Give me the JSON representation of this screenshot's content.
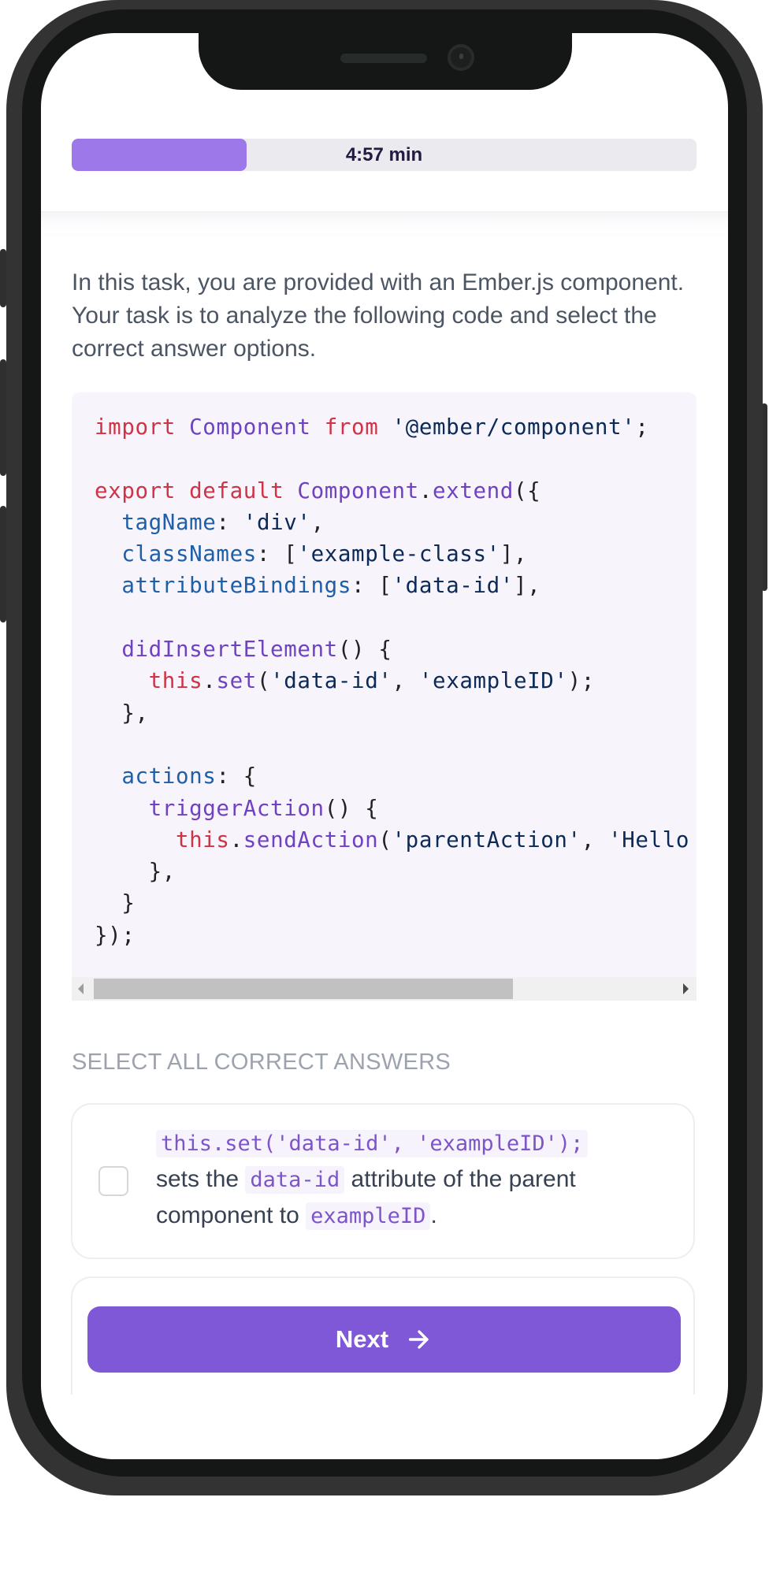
{
  "timer": {
    "label": "4:57 min",
    "progress_fraction": 0.28
  },
  "intro": {
    "text": "In this task, you are provided with an Ember.js component. Your task is to analyze the following code and select the correct answer options."
  },
  "code": {
    "lines": [
      "import Component from '@ember/component';",
      "",
      "export default Component.extend({",
      "  tagName: 'div',",
      "  classNames: ['example-class'],",
      "  attributeBindings: ['data-id'],",
      "",
      "  didInsertElement() {",
      "    this.set('data-id', 'exampleID');",
      "  },",
      "",
      "  actions: {",
      "    triggerAction() {",
      "      this.sendAction('parentAction', 'Hello",
      "    },",
      "  }",
      "});"
    ],
    "scroll_position_fraction": 0
  },
  "question": {
    "instruction": "Select all correct answers",
    "answers": [
      {
        "checked": false,
        "code": "this.set('data-id', 'exampleID');",
        "text_part1": "sets the",
        "inline_code1": "data-id",
        "text_part2": "attribute of the parent component to",
        "inline_code2": "exampleID",
        "text_part3": "."
      }
    ]
  },
  "footer": {
    "next_label": "Next",
    "next_icon": "arrow-right-icon"
  },
  "colors": {
    "accent": "#7f58d8",
    "progress_fill": "#9c78e8",
    "keyword": "#cf3446",
    "function": "#6f42c1",
    "property": "#1f5fa8",
    "string": "#0b2a57"
  }
}
